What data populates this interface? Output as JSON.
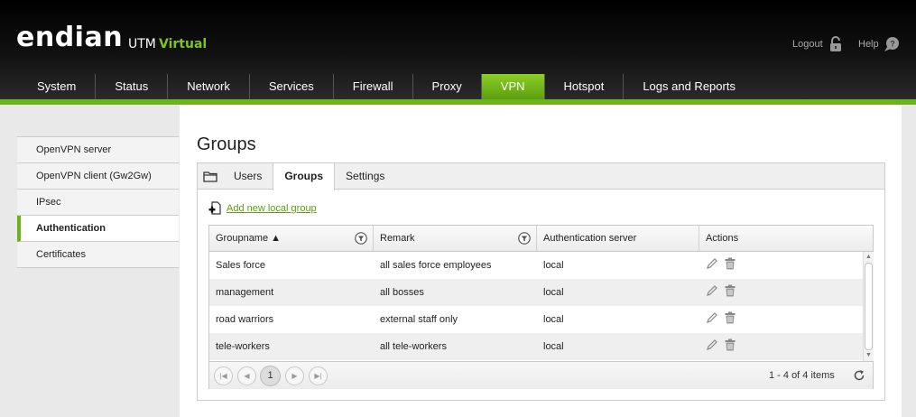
{
  "brand": {
    "logo": "endian",
    "utm": "UTM",
    "virtual": "Virtual"
  },
  "header_links": {
    "logout": "Logout",
    "help": "Help"
  },
  "nav": [
    {
      "label": "System"
    },
    {
      "label": "Status"
    },
    {
      "label": "Network"
    },
    {
      "label": "Services"
    },
    {
      "label": "Firewall"
    },
    {
      "label": "Proxy"
    },
    {
      "label": "VPN",
      "active": true
    },
    {
      "label": "Hotspot"
    },
    {
      "label": "Logs and Reports"
    }
  ],
  "sidebar": {
    "items": [
      {
        "label": "OpenVPN server"
      },
      {
        "label": "OpenVPN client (Gw2Gw)"
      },
      {
        "label": "IPsec"
      },
      {
        "label": "Authentication",
        "active": true
      },
      {
        "label": "Certificates"
      }
    ]
  },
  "page": {
    "title": "Groups"
  },
  "tabs": [
    {
      "label": "Users"
    },
    {
      "label": "Groups",
      "active": true
    },
    {
      "label": "Settings"
    }
  ],
  "add_link": "Add new local group",
  "grid": {
    "columns": [
      "Groupname ▲",
      "Remark",
      "Authentication server",
      "Actions"
    ],
    "rows": [
      [
        "Sales force",
        "all sales force employees",
        "local"
      ],
      [
        "management",
        "all bosses",
        "local"
      ],
      [
        "road warriors",
        "external staff only",
        "local"
      ],
      [
        "tele-workers",
        "all tele-workers",
        "local"
      ]
    ]
  },
  "pager": {
    "first": "|◀",
    "prev": "◀",
    "page": "1",
    "next": "▶",
    "last": "▶|",
    "info": "1 - 4 of 4 items"
  },
  "colors": {
    "accent": "#6cb31a",
    "brand_virtual": "#7fc31c"
  },
  "icons": {
    "logout": "padlock-icon",
    "help": "speech-bubble-icon",
    "folder": "folder-icon",
    "add": "add-document-icon",
    "filter": "filter-icon",
    "edit": "pencil-icon",
    "delete": "trash-icon",
    "refresh": "refresh-icon"
  }
}
